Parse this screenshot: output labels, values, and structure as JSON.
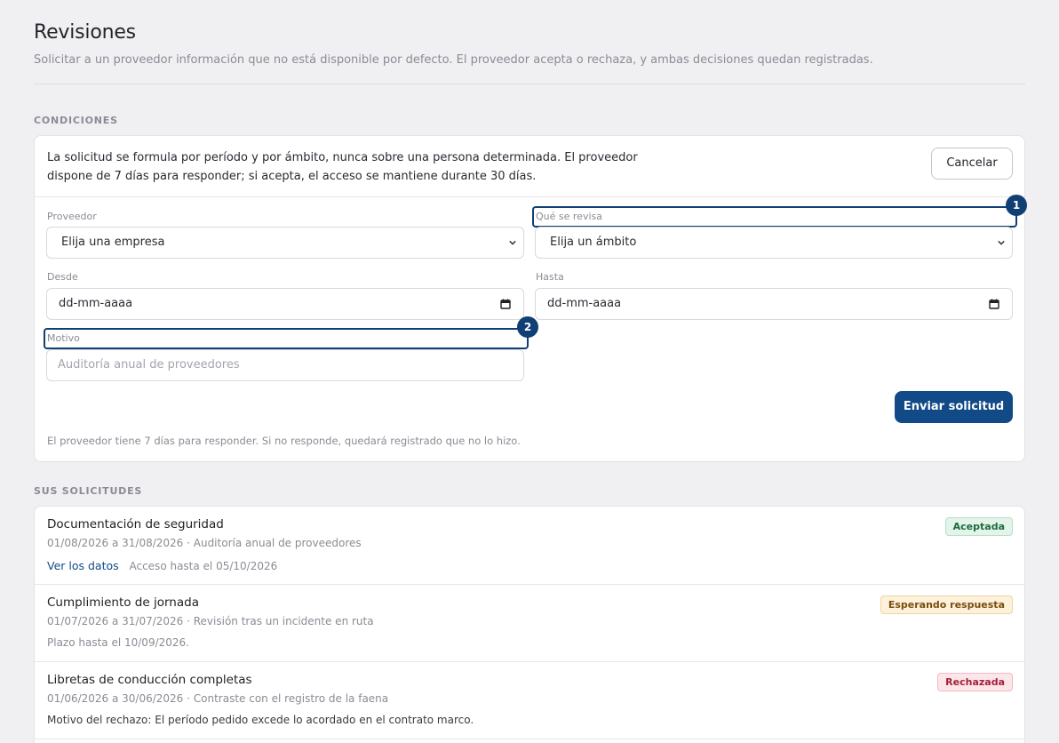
{
  "header": {
    "title": "Revisiones",
    "subtitle": "Solicitar a un proveedor información que no está disponible por defecto. El proveedor acepta o rechaza, y ambas decisiones quedan registradas."
  },
  "conditions": {
    "section_label": "CONDICIONES",
    "description": "La solicitud se formula por período y por ámbito, nunca sobre una persona determinada. El proveedor dispone de 7 días para responder; si acepta, el acceso se mantiene durante 30 días.",
    "cancel_label": "Cancelar",
    "fields": {
      "provider": {
        "label": "Proveedor",
        "value": "Elija una empresa"
      },
      "scope": {
        "label": "Qué se revisa",
        "value": "Elija un ámbito"
      },
      "from": {
        "label": "Desde",
        "value": "dd-mm-aaaa"
      },
      "to": {
        "label": "Hasta",
        "value": "dd-mm-aaaa"
      },
      "reason": {
        "label": "Motivo",
        "placeholder": "Auditoría anual de proveedores"
      }
    },
    "submit_label": "Enviar solicitud",
    "footnote": "El proveedor tiene 7 días para responder. Si no responde, quedará registrado que no lo hizo.",
    "markers": [
      "1",
      "2"
    ]
  },
  "requests": {
    "section_label": "SUS SOLICITUDES",
    "items": [
      {
        "title": "Documentación de seguridad",
        "meta": "01/08/2026 a 31/08/2026 · Auditoría anual de proveedores",
        "link": "Ver los datos",
        "extra": "Acceso hasta el 05/10/2026",
        "status": "Aceptada"
      },
      {
        "title": "Cumplimiento de jornada",
        "meta": "01/07/2026 a 31/07/2026 · Revisión tras un incidente en ruta",
        "extra": "Plazo hasta el 10/09/2026.",
        "status": "Esperando respuesta"
      },
      {
        "title": "Libretas de conducción completas",
        "meta": "01/06/2026 a 30/06/2026 · Contraste con el registro de la faena",
        "extra": "Motivo del rechazo: El período pedido excede lo acordado en el contrato marco.",
        "status": "Rechazada"
      }
    ]
  },
  "colors": {
    "accent": "#114a86",
    "highlight": "#103f74",
    "accepted": "#1e6b3f",
    "pending": "#7a4d0b",
    "rejected": "#a4213a"
  }
}
